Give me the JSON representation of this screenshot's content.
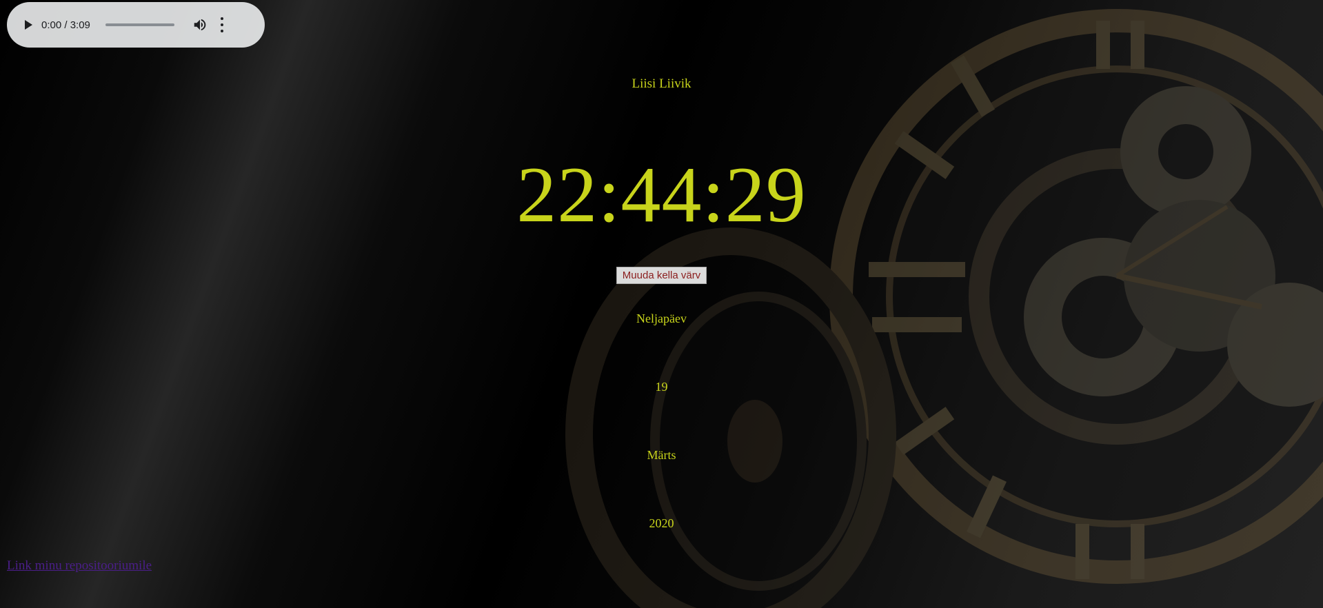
{
  "audio": {
    "time": "0:00 / 3:09",
    "progress": 0,
    "icons": [
      "play-icon",
      "volume-icon",
      "more-vert-icon"
    ]
  },
  "header": {
    "name": "Liisi Liivik"
  },
  "clock": {
    "time": "22:44:29",
    "color": "#c8d41b"
  },
  "controls": {
    "change_color_label": "Muuda kella värv"
  },
  "date": {
    "weekday": "Neljapäev",
    "day": "19",
    "month": "Märts",
    "year": "2020"
  },
  "footer": {
    "repo_link": "Link minu repositooriumile"
  }
}
